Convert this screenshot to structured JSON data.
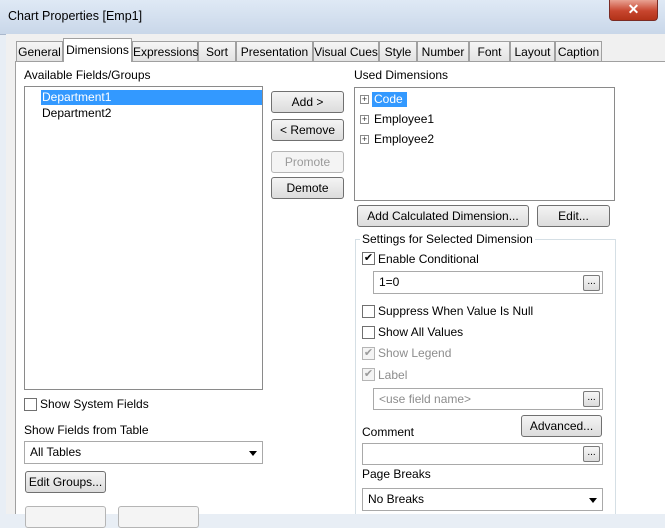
{
  "window": {
    "title": "Chart Properties [Emp1]",
    "close_glyph": "✕"
  },
  "tabs": [
    {
      "label": "General"
    },
    {
      "label": "Dimensions"
    },
    {
      "label": "Expressions"
    },
    {
      "label": "Sort"
    },
    {
      "label": "Presentation"
    },
    {
      "label": "Visual Cues"
    },
    {
      "label": "Style"
    },
    {
      "label": "Number"
    },
    {
      "label": "Font"
    },
    {
      "label": "Layout"
    },
    {
      "label": "Caption"
    }
  ],
  "active_tab": "Dimensions",
  "available": {
    "label": "Available Fields/Groups",
    "items": [
      {
        "label": "Department1",
        "selected": true
      },
      {
        "label": "Department2",
        "selected": false
      }
    ]
  },
  "buttons": {
    "add": "Add >",
    "remove": "< Remove",
    "promote": "Promote",
    "demote": "Demote",
    "add_calculated": "Add Calculated Dimension...",
    "edit": "Edit...",
    "advanced": "Advanced...",
    "edit_groups": "Edit Groups...",
    "ellipsis": "..."
  },
  "used": {
    "label": "Used Dimensions",
    "items": [
      {
        "label": "Code",
        "selected": true
      },
      {
        "label": "Employee1",
        "selected": false
      },
      {
        "label": "Employee2",
        "selected": false
      }
    ]
  },
  "settings": {
    "title": "Settings for Selected Dimension",
    "enable_conditional": {
      "label": "Enable Conditional",
      "checked": true
    },
    "condition_value": "1=0",
    "suppress_null": {
      "label": "Suppress When Value Is Null",
      "checked": false
    },
    "show_all_values": {
      "label": "Show All Values",
      "checked": false
    },
    "show_legend": {
      "label": "Show Legend",
      "checked": true,
      "disabled": true
    },
    "label_opt": {
      "label": "Label",
      "checked": true,
      "disabled": true
    },
    "label_placeholder": "<use field name>",
    "comment_label": "Comment",
    "comment_value": "",
    "page_breaks_label": "Page Breaks",
    "page_breaks_value": "No Breaks"
  },
  "left_bottom": {
    "show_system_fields": {
      "label": "Show System Fields",
      "checked": false
    },
    "show_fields_from_label": "Show Fields from Table",
    "table_value": "All Tables"
  },
  "colors": {
    "selection": "#3399ff",
    "close": "#c7452e"
  }
}
